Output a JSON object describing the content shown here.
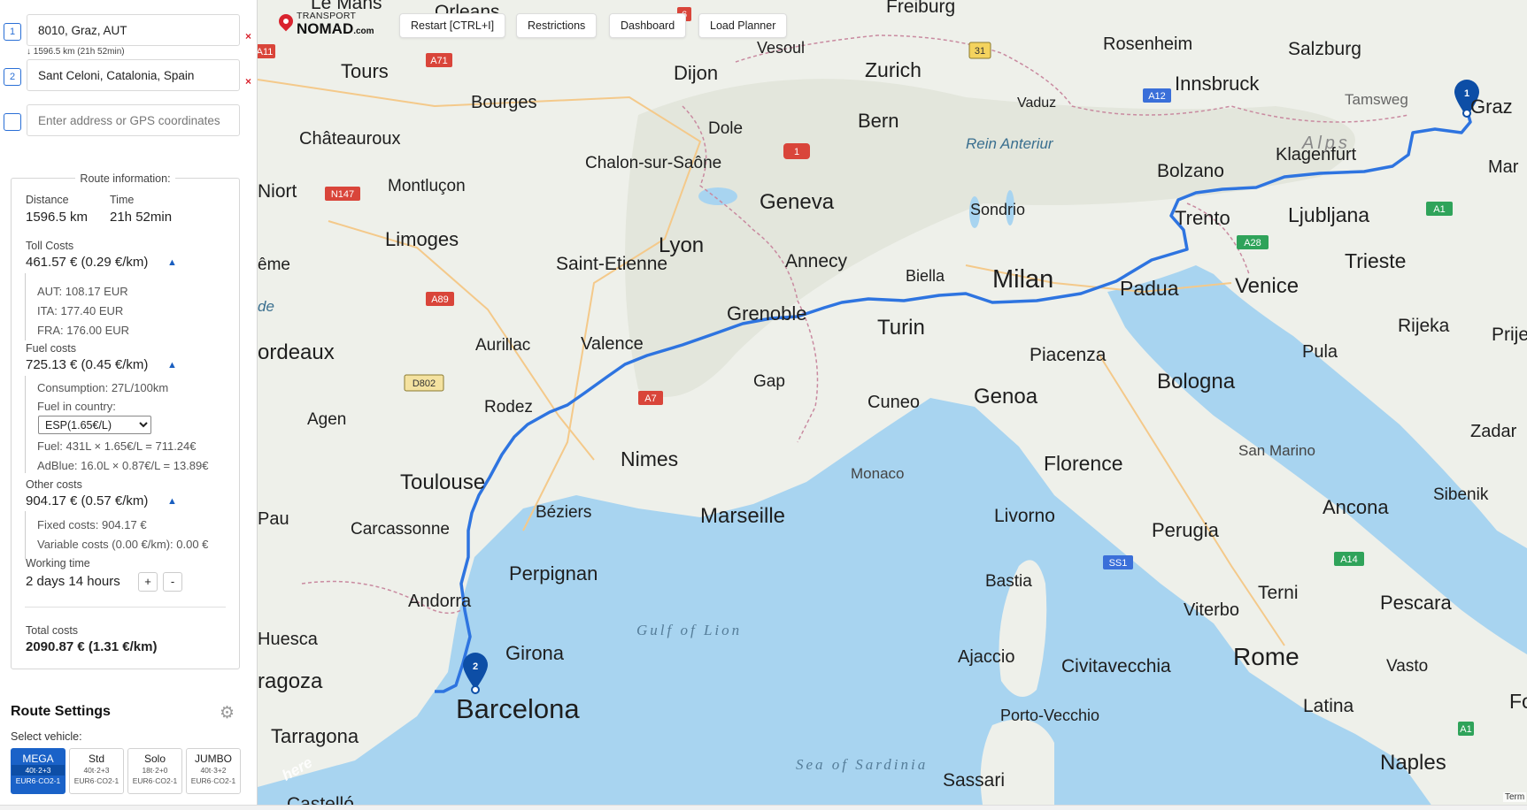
{
  "waypoints": [
    {
      "num": "1",
      "value": "8010, Graz, AUT",
      "remove": "×"
    },
    {
      "num": "2",
      "value": "Sant Celoni, Catalonia, Spain",
      "remove": "×"
    },
    {
      "num": "",
      "placeholder": "Enter address or GPS coordinates"
    }
  ],
  "leg_info": "↓ 1596.5 km (21h 52min)",
  "route_info": {
    "title": "Route information:",
    "distance_label": "Distance",
    "distance": "1596.5 km",
    "time_label": "Time",
    "time": "21h 52min",
    "toll_label": "Toll Costs",
    "toll_total": "461.57 € (0.29 €/km)",
    "toll_items": [
      "AUT: 108.17 EUR",
      "ITA: 177.40 EUR",
      "FRA: 176.00 EUR"
    ],
    "fuel_label": "Fuel costs",
    "fuel_total": "725.13 € (0.45 €/km)",
    "consumption": "Consumption: 27L/100km",
    "fuel_country_label": "Fuel in country:",
    "fuel_country_selected": "ESP(1.65€/L)",
    "fuel_calc": "Fuel: 431L × 1.65€/L = 711.24€",
    "adblue_calc": "AdBlue: 16.0L × 0.87€/L = 13.89€",
    "other_label": "Other costs",
    "other_total": "904.17 € (0.57 €/km)",
    "fixed_costs": "Fixed costs: 904.17 €",
    "variable_costs": "Variable costs (0.00 €/km): 0.00 €",
    "working_label": "Working time",
    "working_time": "2 days 14 hours",
    "plus": "+",
    "minus": "-",
    "total_label": "Total costs",
    "total": "2090.87 € (1.31 €/km)",
    "toggle": "▲"
  },
  "settings": {
    "title": "Route Settings",
    "gear": "⚙",
    "vehicle_label": "Select vehicle:",
    "vehicles": [
      {
        "name": "MEGA",
        "spec": "40t·2+3",
        "euro": "EUR6·CO2-1",
        "active": true
      },
      {
        "name": "Std",
        "spec": "40t·2+3",
        "euro": "EUR6·CO2-1",
        "active": false
      },
      {
        "name": "Solo",
        "spec": "18t·2+0",
        "euro": "EUR6·CO2-1",
        "active": false
      },
      {
        "name": "JUMBO",
        "spec": "40t·3+2",
        "euro": "EUR6·CO2-1",
        "active": false
      }
    ]
  },
  "toolbar": {
    "logo_top": "TRANSPORT",
    "logo_bottom": "NOMAD",
    "logo_suffix": ".com",
    "restart": "Restart [CTRL+I]",
    "restrictions": "Restrictions",
    "dashboard": "Dashboard",
    "load_planner": "Load Planner"
  },
  "map": {
    "markers": [
      {
        "label": "1"
      },
      {
        "label": "2"
      }
    ],
    "cities": [
      "Le Mans",
      "Orleans",
      "Freiburg",
      "Rosenheim",
      "Salzburg",
      "Tours",
      "Dijon",
      "Zurich",
      "Innsbruck",
      "Graz",
      "Bourges",
      "Vesoul",
      "Vaduz",
      "Tamsweg",
      "Châteauroux",
      "Dole",
      "Bern",
      "Klagenfurt",
      "Mar",
      "Chalon-sur-Saône",
      "Rein Anteriur",
      "Bolzano",
      "Niort",
      "Montluçon",
      "Geneva",
      "Sondrio",
      "Trento",
      "Ljubljana",
      "Limoges",
      "Lyon",
      "Annecy",
      "Saint-Etienne",
      "Biella",
      "Milan",
      "Padua",
      "Venice",
      "Trieste",
      "ême",
      "Grenoble",
      "Turin",
      "Rijeka",
      "Prije",
      "ordeaux",
      "Aurillac",
      "Valence",
      "Piacenza",
      "Pula",
      "Gap",
      "Bologna",
      "Rodez",
      "Cuneo",
      "Genoa",
      "Agen",
      "Zadar",
      "San Marino",
      "Nimes",
      "Florence",
      "Toulouse",
      "Monaco",
      "Livorno",
      "Béziers",
      "Marseille",
      "Perugia",
      "Ancona",
      "Pau",
      "Carcassonne",
      "Sibenik",
      "Perpignan",
      "Bastia",
      "Terni",
      "Andorra",
      "Viterbo",
      "Pescara",
      "Huesca",
      "Girona",
      "Ajaccio",
      "Civitavecchia",
      "Rome",
      "Vasto",
      "ragoza",
      "Barcelona",
      "Porto-Vecchio",
      "Latina",
      "Fogg",
      "Tarragona",
      "Naples",
      "Sassari",
      "Castelló",
      "Alps",
      "de"
    ],
    "seas": [
      "Gulf of Lion",
      "Sea of Sardinia"
    ],
    "shields": [
      "A11",
      "A71",
      "31",
      "A12",
      "N147",
      "A89",
      "D802",
      "A7",
      "A28",
      "A1",
      "SS1",
      "A14",
      "1",
      "6"
    ],
    "attribution": "here",
    "terms": "Term"
  }
}
